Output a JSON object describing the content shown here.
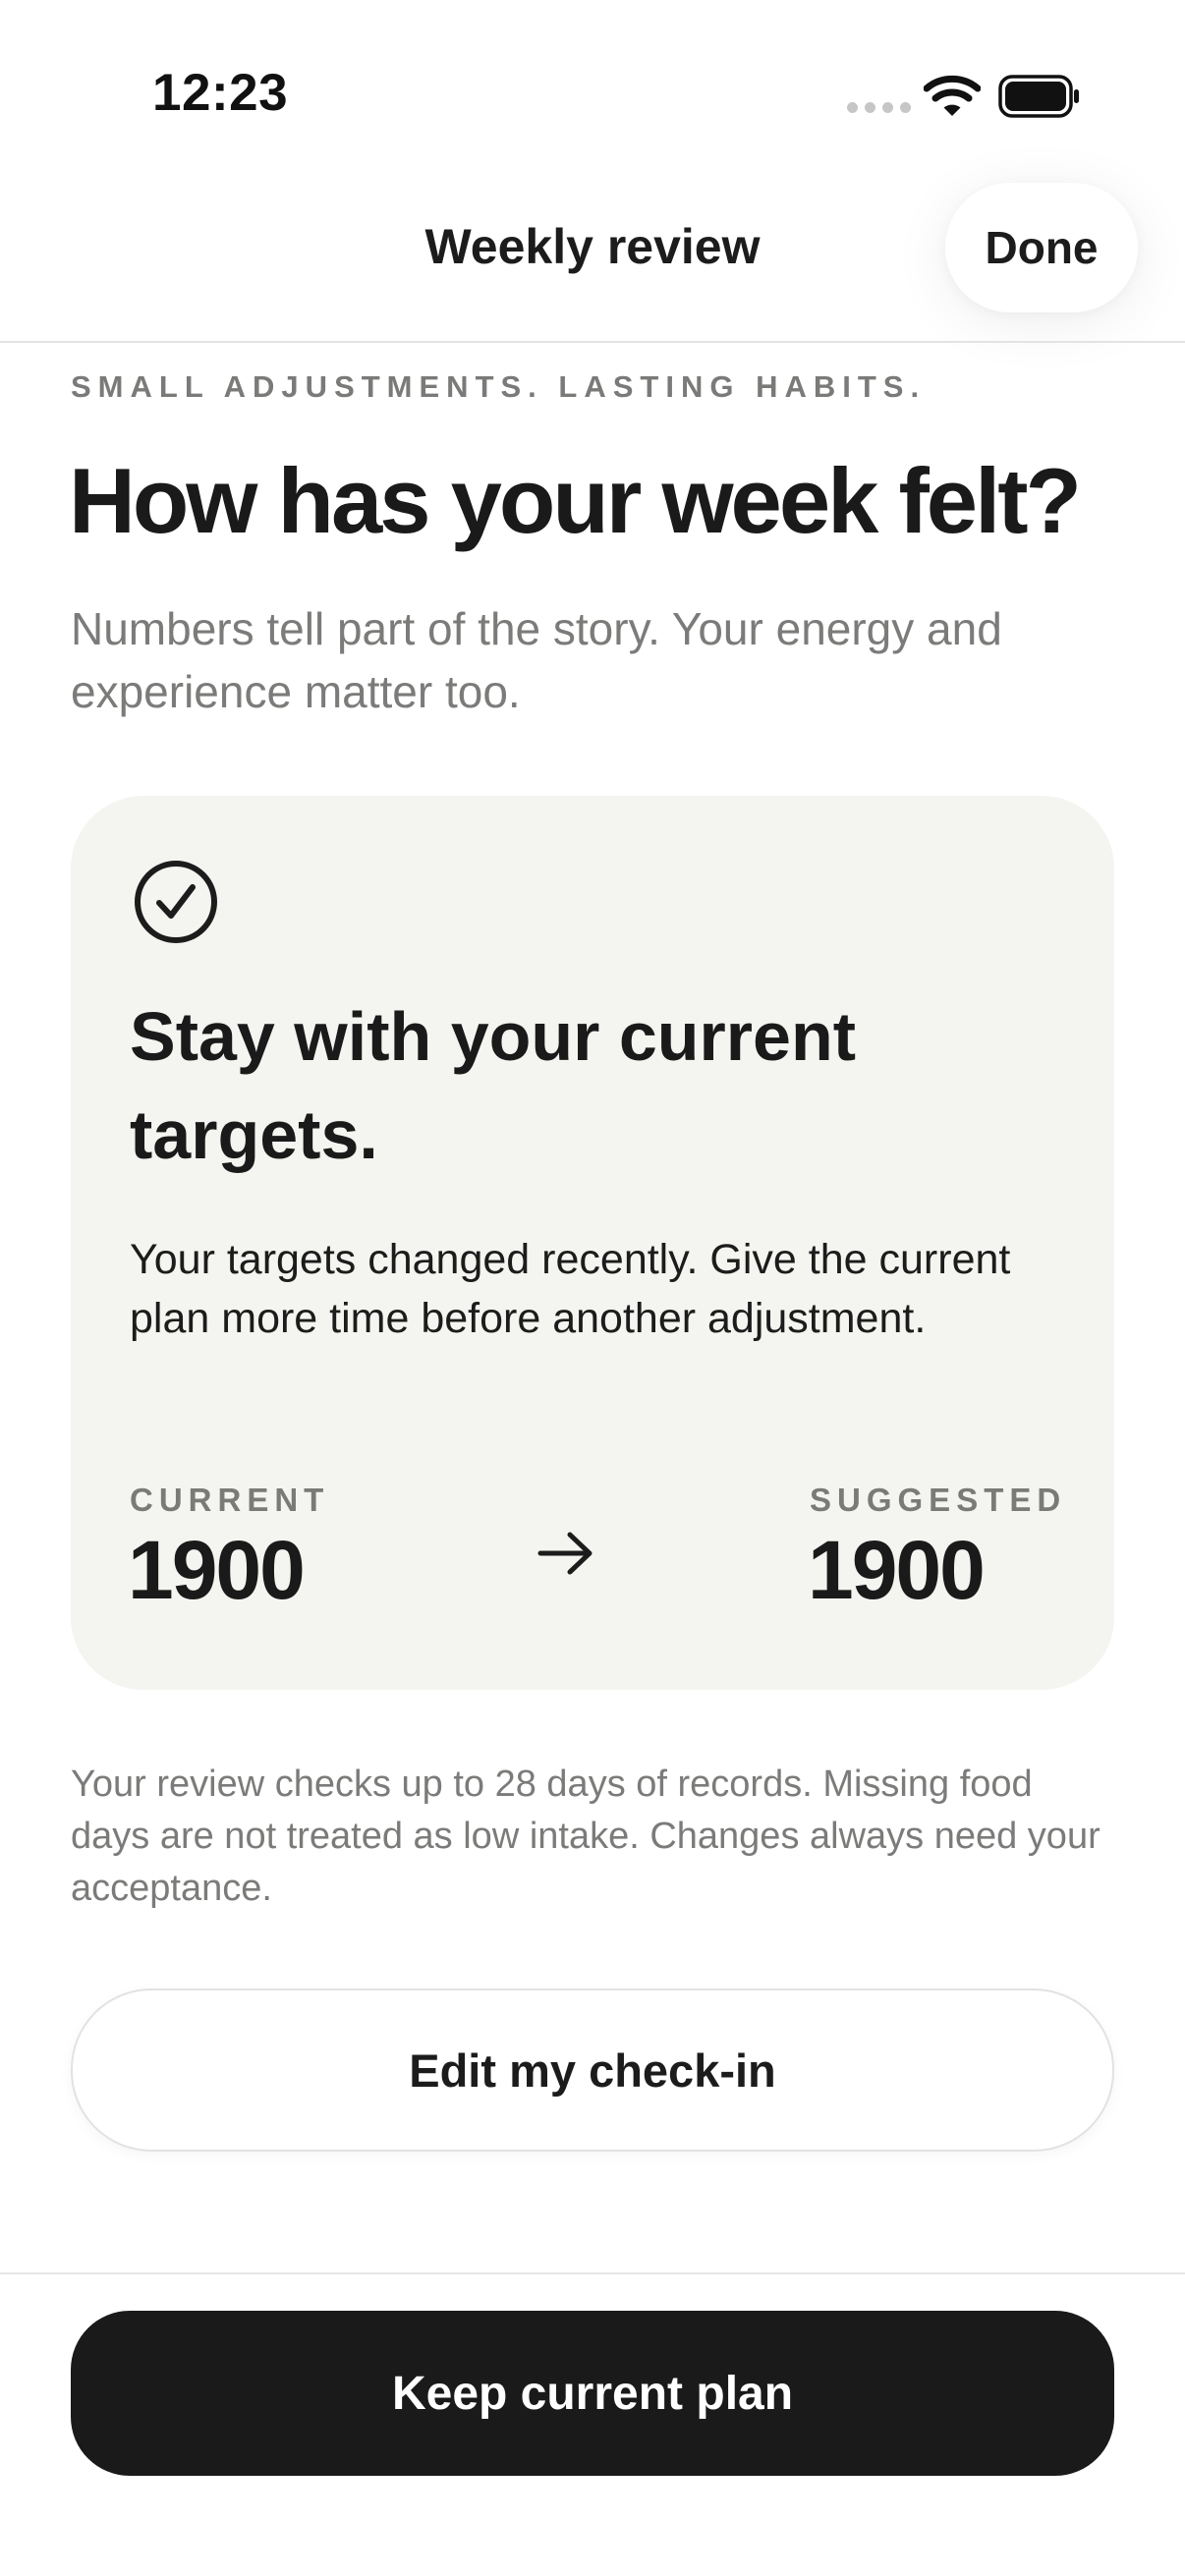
{
  "status_bar": {
    "time": "12:23",
    "icons": [
      "cellular-dots-icon",
      "wifi-icon",
      "battery-icon"
    ]
  },
  "header": {
    "title": "Weekly review",
    "done_label": "Done"
  },
  "intro": {
    "eyebrow": "SMALL ADJUSTMENTS. LASTING HABITS.",
    "title": "How has your week felt?",
    "subtitle": "Numbers tell part of the story. Your energy and experience matter too."
  },
  "recommendation": {
    "icon": "check-circle-icon",
    "title": "Stay with your current targets.",
    "body": "Your targets changed recently. Give the current plan more time before another adjustment.",
    "current_label": "CURRENT",
    "current_value": "1900",
    "arrow_icon": "arrow-right-icon",
    "suggested_label": "SUGGESTED",
    "suggested_value": "1900"
  },
  "footnote": "Your review checks up to 28 days of records. Missing food days are not treated as low intake. Changes always need your acceptance.",
  "actions": {
    "edit_label": "Edit my check-in",
    "keep_label": "Keep current plan"
  },
  "colors": {
    "card_background": "#f4f4f0",
    "primary_button": "#1a1a1a",
    "muted_text": "#7a7a78"
  }
}
